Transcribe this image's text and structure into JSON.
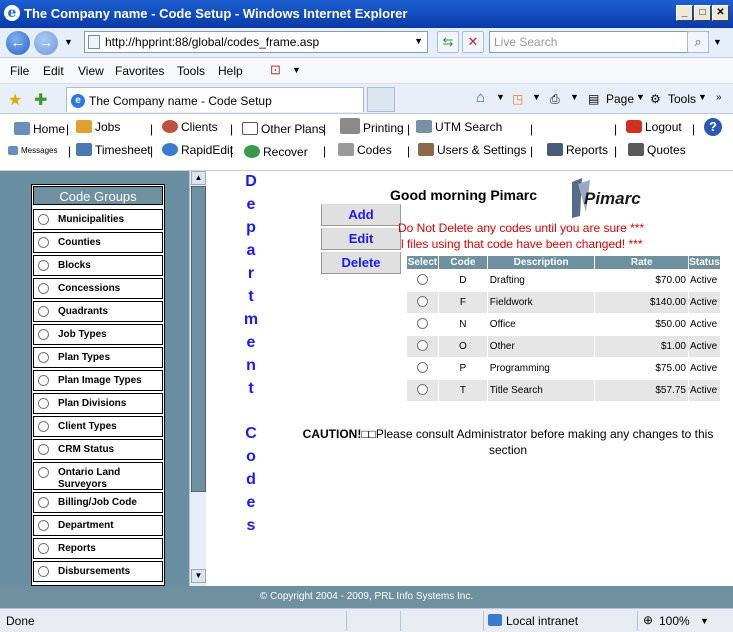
{
  "window": {
    "title": "The Company name - Code Setup - Windows Internet Explorer"
  },
  "browser": {
    "address": "http://hpprint:88/global/codes_frame.asp",
    "search_placeholder": "Live Search",
    "menu": [
      "File",
      "Edit",
      "View",
      "Favorites",
      "Tools",
      "Help"
    ],
    "tab_title": "The Company name - Code Setup",
    "page_menu": "Page",
    "tools_menu": "Tools"
  },
  "app_toolbar": {
    "row1": [
      "Home",
      "Jobs",
      "Clients",
      "Other Plans",
      "Printing",
      "UTM Search",
      "Logout"
    ],
    "row2": [
      "Messages",
      "Timesheet",
      "RapidEdit",
      "Recover",
      "Codes",
      "Users & Settings",
      "Reports",
      "Quotes"
    ]
  },
  "sidebar": {
    "title": "Code Groups",
    "items": [
      "Municipalities",
      "Counties",
      "Blocks",
      "Concessions",
      "Quadrants",
      "Job Types",
      "Plan Types",
      "Plan Image Types",
      "Plan Divisions",
      "Client Types",
      "CRM Status",
      "Ontario Land Surveyors",
      "Billing/Job Code",
      "Department",
      "Reports",
      "Disbursements"
    ]
  },
  "section_label": {
    "word1": [
      "D",
      "e",
      "p",
      "a",
      "r",
      "t",
      "m",
      "e",
      "n",
      "t"
    ],
    "word2": [
      "C",
      "o",
      "d",
      "e",
      "s"
    ]
  },
  "main": {
    "greeting": "Good morning Pimarc",
    "logo": "Pimarc",
    "buttons": {
      "add": "Add",
      "edit": "Edit",
      "delete": "Delete"
    },
    "warning_line1": "Do Not Delete any codes until you are sure ***",
    "warning_line2": "l files using that code have been changed! ***",
    "table": {
      "headers": [
        "Select",
        "Code",
        "Description",
        "Rate",
        "Status"
      ],
      "rows": [
        {
          "code": "D",
          "description": "Drafting",
          "rate": "$70.00",
          "status": "Active"
        },
        {
          "code": "F",
          "description": "Fieldwork",
          "rate": "$140.00",
          "status": "Active"
        },
        {
          "code": "N",
          "description": "Office",
          "rate": "$50.00",
          "status": "Active"
        },
        {
          "code": "O",
          "description": "Other",
          "rate": "$1.00",
          "status": "Active"
        },
        {
          "code": "P",
          "description": "Programming",
          "rate": "$75.00",
          "status": "Active"
        },
        {
          "code": "T",
          "description": "Title Search",
          "rate": "$57.75",
          "status": "Active"
        }
      ]
    },
    "caution_bold": "CAUTION!",
    "caution_text": "□□Please consult Administrator before making any changes to this section"
  },
  "footer": {
    "copyright": "© Copyright 2004 - 2009, PRL Info Systems Inc."
  },
  "statusbar": {
    "left": "Done",
    "zone": "Local intranet",
    "zoom": "100%"
  }
}
